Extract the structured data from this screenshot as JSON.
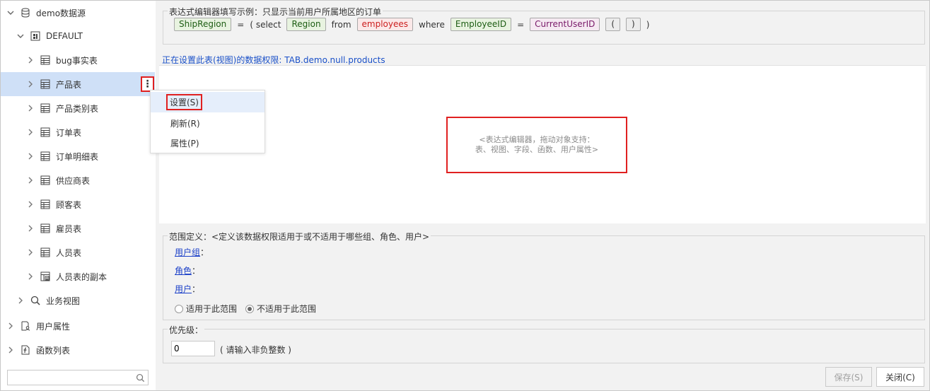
{
  "tree": {
    "datasource": "demo数据源",
    "schema": "DEFAULT",
    "tables": [
      "bug事实表",
      "产品表",
      "产品类别表",
      "订单表",
      "订单明细表",
      "供应商表",
      "顾客表",
      "雇员表",
      "人员表",
      "人员表的副本"
    ],
    "business_view": "业务视图",
    "user_attributes": "用户属性",
    "function_list": "函数列表"
  },
  "context_menu": {
    "settings": "设置(S)",
    "refresh": "刷新(R)",
    "properties": "属性(P)"
  },
  "example": {
    "legend": "表达式编辑器填写示例：只显示当前用户所属地区的订单",
    "field1": "ShipRegion",
    "eq": "=",
    "open_select": "( select",
    "field2": "Region",
    "from": "from",
    "table": "employees",
    "where": "where",
    "field3": "EmployeeID",
    "eq2": "=",
    "user_attr": "CurrentUserID",
    "paren_open": "(",
    "paren_close": ")",
    "close": ")"
  },
  "info_line": "正在设置此表(视图)的数据权限: TAB.demo.null.products",
  "editor_hint": {
    "line1": "<表达式编辑器，拖动对象支持：",
    "line2": "表、视图、字段、函数、用户属性>"
  },
  "scope": {
    "legend": "范围定义：<定义该数据权限适用于或不适用于哪些组、角色、用户>",
    "user_group": "用户组",
    "role": "角色",
    "user": "用户",
    "colon": "：",
    "apply": "适用于此范围",
    "not_apply": "不适用于此范围"
  },
  "priority": {
    "legend": "优先级：",
    "value": "0",
    "note": "( 请输入非负整数 )"
  },
  "buttons": {
    "save": "保存(S)",
    "close": "关闭(C)"
  }
}
